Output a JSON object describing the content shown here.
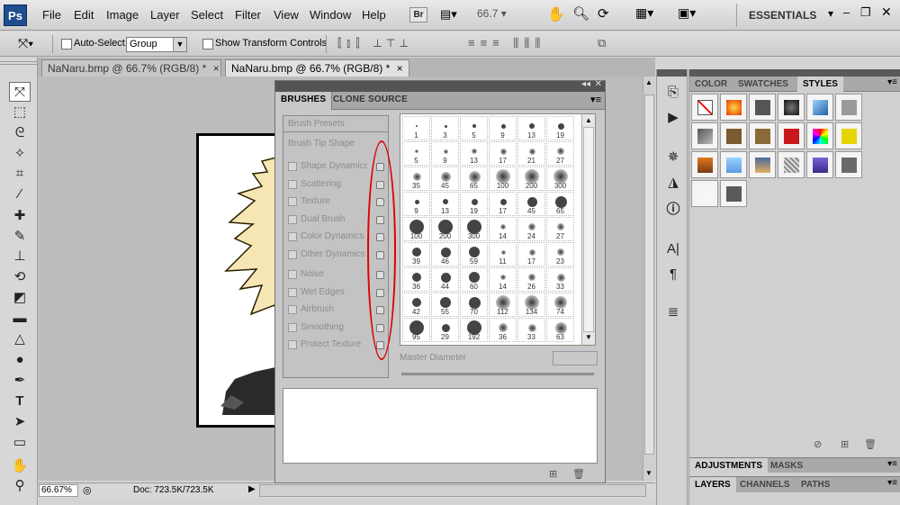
{
  "app": {
    "logo": "Ps",
    "workspace": "ESSENTIALS",
    "bridge": "Br",
    "zoom_combo": "66.7"
  },
  "menu": [
    "File",
    "Edit",
    "Image",
    "Layer",
    "Select",
    "Filter",
    "View",
    "Window",
    "Help"
  ],
  "options": {
    "auto_select_label": "Auto-Select:",
    "auto_select_value": "Group",
    "transform_label": "Show Transform Controls"
  },
  "tabs": [
    "NaNaru.bmp @ 66.7% (RGB/8) *",
    "NaNaru.bmp @ 66.7% (RGB/8) *"
  ],
  "status": {
    "zoom": "66.67%",
    "doc": "Doc: 723.5K/723.5K"
  },
  "brushes": {
    "tabs": [
      "BRUSHES",
      "CLONE SOURCE"
    ],
    "presets_label": "Brush Presets",
    "tip_label": "Brush Tip Shape",
    "options": [
      "Shape Dynamics",
      "Scattering",
      "Texture",
      "Dual Brush",
      "Color Dynamics",
      "Other Dynamics",
      "Noise",
      "Wet Edges",
      "Airbrush",
      "Smoothing",
      "Protect Texture"
    ],
    "master_label": "Master Diameter",
    "sizes": [
      "1",
      "3",
      "5",
      "9",
      "13",
      "19",
      "5",
      "9",
      "13",
      "17",
      "21",
      "27",
      "35",
      "45",
      "65",
      "100",
      "200",
      "300",
      "9",
      "13",
      "19",
      "17",
      "45",
      "65",
      "100",
      "200",
      "300",
      "14",
      "24",
      "27",
      "39",
      "46",
      "59",
      "11",
      "17",
      "23",
      "36",
      "44",
      "60",
      "14",
      "26",
      "33",
      "42",
      "55",
      "70",
      "112",
      "134",
      "74",
      "95",
      "29",
      "192",
      "36",
      "33",
      "63"
    ]
  },
  "right": {
    "top_tabs": [
      "COLOR",
      "SWATCHES",
      "STYLES"
    ],
    "adj_tabs": [
      "ADJUSTMENTS",
      "MASKS"
    ],
    "layer_tabs": [
      "LAYERS",
      "CHANNELS",
      "PATHS"
    ]
  },
  "colors": {
    "annotation": "#e00000",
    "ps_blue": "#1f4d8f"
  }
}
